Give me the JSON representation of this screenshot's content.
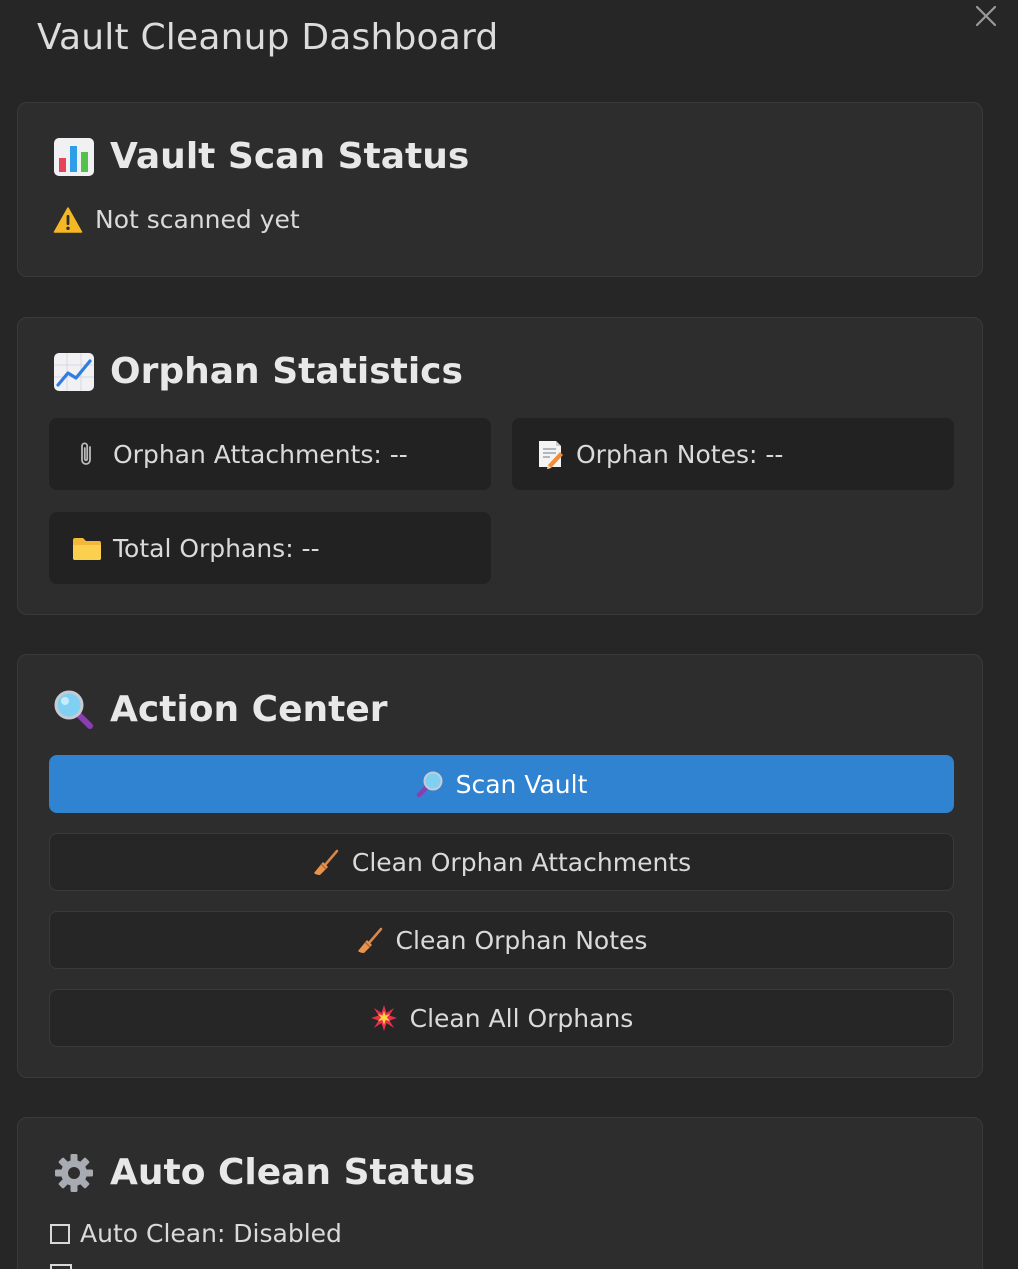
{
  "header": {
    "title": "Vault Cleanup Dashboard",
    "close_icon": "close-icon"
  },
  "scan_status": {
    "heading": "Vault Scan Status",
    "heading_icon": "bar-chart-icon",
    "status_text": "Not scanned yet",
    "status_icon": "warning-icon"
  },
  "orphan_stats": {
    "heading": "Orphan Statistics",
    "heading_icon": "trend-chart-icon",
    "attachments": {
      "icon": "paperclip-icon",
      "label": "Orphan Attachments: --"
    },
    "notes": {
      "icon": "memo-icon",
      "label": "Orphan Notes: --"
    },
    "total": {
      "icon": "folder-icon",
      "label": "Total Orphans: --"
    }
  },
  "action_center": {
    "heading": "Action Center",
    "heading_icon": "magnifier-icon",
    "buttons": [
      {
        "icon": "magnifier-icon",
        "label": "Scan Vault",
        "primary": true
      },
      {
        "icon": "broom-icon",
        "label": "Clean Orphan Attachments"
      },
      {
        "icon": "broom-icon",
        "label": "Clean Orphan Notes"
      },
      {
        "icon": "collision-icon",
        "label": "Clean All Orphans"
      }
    ]
  },
  "auto_clean": {
    "heading": "Auto Clean Status",
    "heading_icon": "gear-icon",
    "status_label": "Auto Clean: Disabled",
    "checked": false
  },
  "colors": {
    "background": "#262626",
    "card": "#2d2d2d",
    "stat_box": "#222222",
    "primary_button": "#2f83d1",
    "text": "#dadada"
  }
}
